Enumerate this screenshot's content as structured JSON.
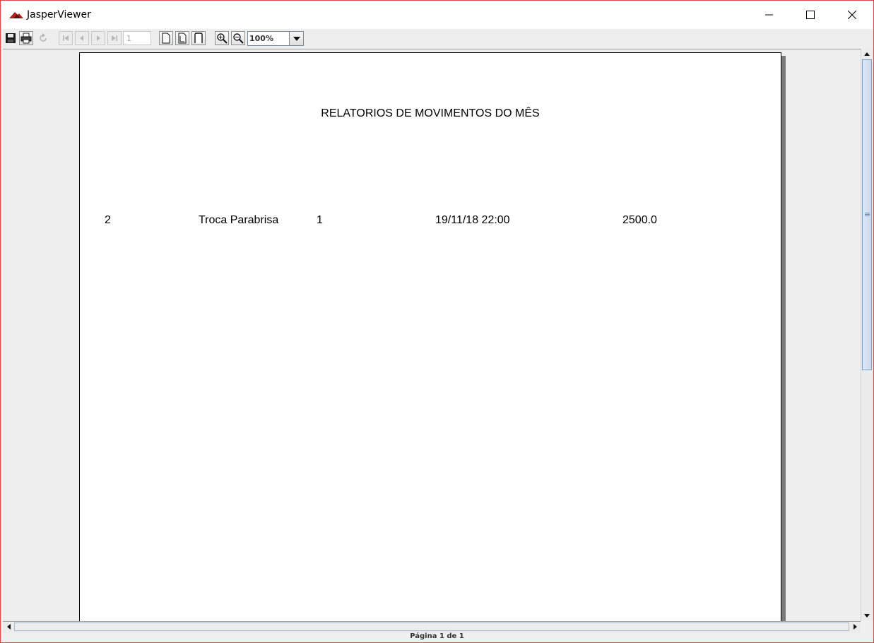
{
  "window": {
    "title": "JasperViewer"
  },
  "toolbar": {
    "page_number": "1",
    "zoom": "100%"
  },
  "report": {
    "title": "RELATORIOS DE MOVIMENTOS DO MÊS",
    "rows": [
      [
        "2",
        "Troca Parabrisa",
        "1",
        "19/11/18 22:00",
        "2500.0"
      ]
    ]
  },
  "status": {
    "text": "Página 1 de 1"
  },
  "colors": {
    "window_border": "#e04848",
    "app_icon": "#b01e1e",
    "scroll_thumb": "#c9d9ec"
  },
  "icons": [
    "app-icon",
    "minimize-icon",
    "maximize-icon",
    "close-icon",
    "save-icon",
    "print-icon",
    "reload-icon",
    "first-page-icon",
    "previous-page-icon",
    "next-page-icon",
    "last-page-icon",
    "actual-size-icon",
    "fit-page-icon",
    "fit-width-icon",
    "zoom-in-icon",
    "zoom-out-icon",
    "dropdown-arrow-icon"
  ]
}
